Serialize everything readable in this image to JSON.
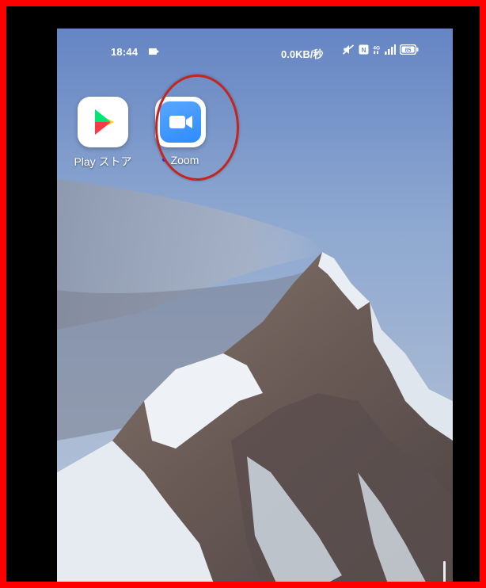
{
  "statusbar": {
    "time": "18:44",
    "network_speed": "0.0KB/秒",
    "icons": [
      "video-record-icon",
      "mute-icon",
      "nfc-icon",
      "4g-icon",
      "signal-icon",
      "battery-icon"
    ],
    "battery": "85"
  },
  "home": {
    "apps": [
      {
        "label": "Play ストア",
        "icon": "google-play-icon",
        "notification_dot": false
      },
      {
        "label": "Zoom",
        "icon": "zoom-video-icon",
        "notification_dot": true
      }
    ]
  },
  "colors": {
    "frame_border": "#ff0000",
    "highlight_circle": "#c3261f",
    "zoom_blue": "#2d8cff",
    "notification_dot": "#1a3df0"
  }
}
